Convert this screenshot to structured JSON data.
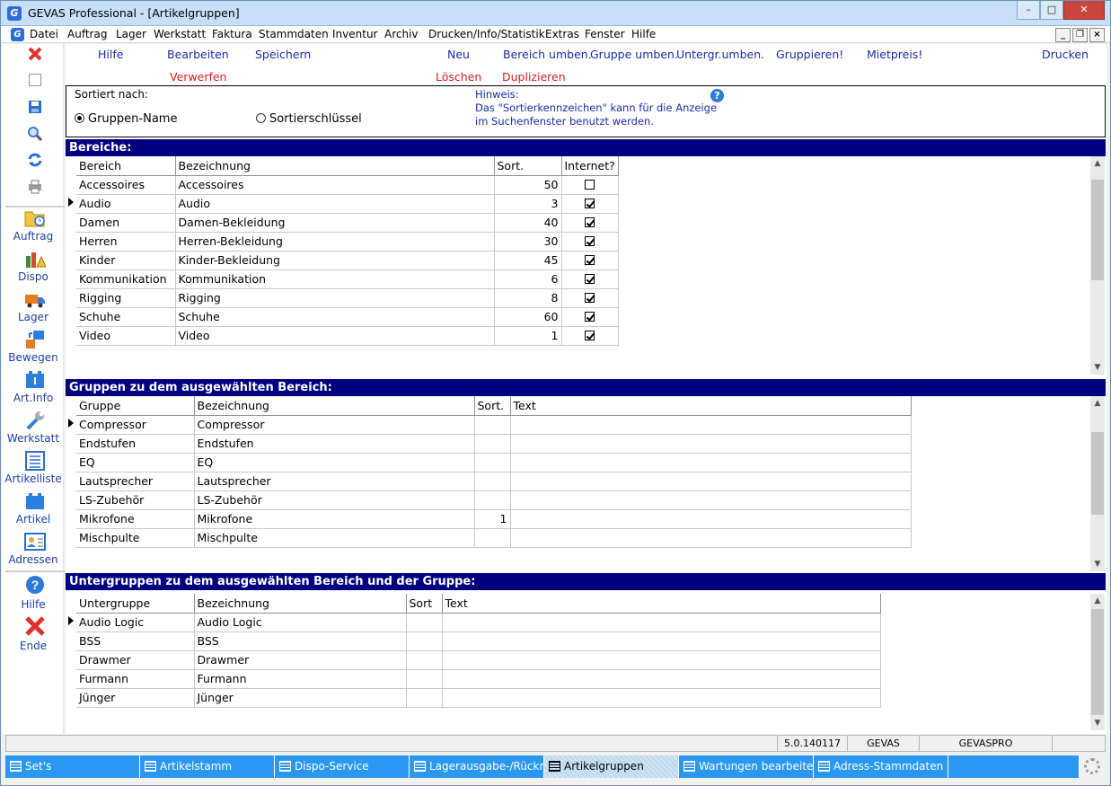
{
  "window": {
    "title": "GEVAS Professional - [Artikelgruppen]",
    "controls": {
      "minimize": "–",
      "maximize": "□",
      "close": "✕"
    },
    "mdi_controls": {
      "minimize": "_",
      "restore": "❐",
      "close": "×"
    }
  },
  "menu": [
    "Datei",
    "Auftrag",
    "Lager",
    "Werkstatt",
    "Faktura",
    "Stammdaten",
    "Inventur",
    "Archiv",
    "Drucken/Info/Statistik",
    "Extras",
    "Fenster",
    "Hilfe"
  ],
  "sidebar": {
    "items": [
      {
        "label": "Auftrag",
        "icon": "folder-clock-icon"
      },
      {
        "label": "Dispo",
        "icon": "warning-chart-icon"
      },
      {
        "label": "Lager",
        "icon": "truck-icon"
      },
      {
        "label": "Bewegen",
        "icon": "move-arrows-icon"
      },
      {
        "label": "Art.Info",
        "icon": "info-box-icon"
      },
      {
        "label": "Werkstatt",
        "icon": "wrench-icon"
      },
      {
        "label": "Artikelliste",
        "icon": "list-icon"
      },
      {
        "label": "Artikel",
        "icon": "box-icon"
      },
      {
        "label": "Adressen",
        "icon": "address-card-icon"
      },
      {
        "label": "Hilfe",
        "icon": "help-icon"
      },
      {
        "label": "Ende",
        "icon": "exit-icon"
      }
    ]
  },
  "toolbar": {
    "row1": [
      "Hilfe",
      "Bearbeiten",
      "Speichern",
      "Neu",
      "Bereich umben.",
      "Gruppe umben.",
      "Untergr.umben.",
      "Gruppieren!",
      "Mietpreis!",
      "Drucken"
    ],
    "row2": [
      "Verwerfen",
      "Löschen",
      "Duplizieren"
    ]
  },
  "sort": {
    "label": "Sortiert nach:",
    "options": [
      "Gruppen-Name",
      "Sortierschlüssel"
    ],
    "selected": "Gruppen-Name",
    "hint_title": "Hinweis:",
    "hint_line1": "Das \"Sortierkennzeichen\" kann für die Anzeige",
    "hint_line2": "im Suchenfenster benutzt werden."
  },
  "bereiche": {
    "title": "Bereiche:",
    "columns": [
      "Bereich",
      "Bezeichnung",
      "Sort.",
      "Internet?"
    ],
    "rows": [
      {
        "bereich": "Accessoires",
        "bezeichnung": "Accessoires",
        "sort": "50",
        "internet": false
      },
      {
        "bereich": "Audio",
        "bezeichnung": "Audio",
        "sort": "3",
        "internet": true
      },
      {
        "bereich": "Damen",
        "bezeichnung": "Damen-Bekleidung",
        "sort": "40",
        "internet": true
      },
      {
        "bereich": "Herren",
        "bezeichnung": "Herren-Bekleidung",
        "sort": "30",
        "internet": true
      },
      {
        "bereich": "Kinder",
        "bezeichnung": "Kinder-Bekleidung",
        "sort": "45",
        "internet": true
      },
      {
        "bereich": "Kommunikation",
        "bezeichnung": "Kommunikation",
        "sort": "6",
        "internet": true
      },
      {
        "bereich": "Rigging",
        "bezeichnung": "Rigging",
        "sort": "8",
        "internet": true
      },
      {
        "bereich": "Schuhe",
        "bezeichnung": "Schuhe",
        "sort": "60",
        "internet": true
      },
      {
        "bereich": "Video",
        "bezeichnung": "Video",
        "sort": "1",
        "internet": true
      }
    ],
    "selected_index": 1
  },
  "gruppen": {
    "title": "Gruppen zu dem ausgewählten Bereich:",
    "columns": [
      "Gruppe",
      "Bezeichnung",
      "Sort.",
      "Text"
    ],
    "rows": [
      {
        "gruppe": "Compressor",
        "bezeichnung": "Compressor",
        "sort": "",
        "text": ""
      },
      {
        "gruppe": "Endstufen",
        "bezeichnung": "Endstufen",
        "sort": "",
        "text": ""
      },
      {
        "gruppe": "EQ",
        "bezeichnung": "EQ",
        "sort": "",
        "text": ""
      },
      {
        "gruppe": "Lautsprecher",
        "bezeichnung": "Lautsprecher",
        "sort": "",
        "text": ""
      },
      {
        "gruppe": "LS-Zubehör",
        "bezeichnung": "LS-Zubehör",
        "sort": "",
        "text": ""
      },
      {
        "gruppe": "Mikrofone",
        "bezeichnung": "Mikrofone",
        "sort": "1",
        "text": ""
      },
      {
        "gruppe": "Mischpulte",
        "bezeichnung": "Mischpulte",
        "sort": "",
        "text": ""
      }
    ],
    "selected_index": 0
  },
  "untergruppen": {
    "title": "Untergruppen zu dem ausgewählten Bereich und der Gruppe:",
    "columns": [
      "Untergruppe",
      "Bezeichnung",
      "Sort",
      "Text"
    ],
    "rows": [
      {
        "untergruppe": "Audio Logic",
        "bezeichnung": "Audio Logic",
        "sort": "",
        "text": ""
      },
      {
        "untergruppe": "BSS",
        "bezeichnung": "BSS",
        "sort": "",
        "text": ""
      },
      {
        "untergruppe": "Drawmer",
        "bezeichnung": "Drawmer",
        "sort": "",
        "text": ""
      },
      {
        "untergruppe": "Furmann",
        "bezeichnung": "Furmann",
        "sort": "",
        "text": ""
      },
      {
        "untergruppe": "Jünger",
        "bezeichnung": "Jünger",
        "sort": "",
        "text": ""
      }
    ],
    "selected_index": 0
  },
  "statusbar": {
    "version": "5.0.140117",
    "user": "GEVAS",
    "db": "GEVASPRO"
  },
  "taskbar": [
    {
      "label": "Set's",
      "active": false
    },
    {
      "label": "Artikelstamm",
      "active": false
    },
    {
      "label": "Dispo-Service",
      "active": false
    },
    {
      "label": "Lagerausgabe-/Rückn...",
      "active": false
    },
    {
      "label": "Artikelgruppen",
      "active": true
    },
    {
      "label": "Wartungen bearbeiten",
      "active": false
    },
    {
      "label": "Adress-Stammdaten",
      "active": false
    }
  ],
  "colors": {
    "section": "#000080",
    "toolbar_blue": "#1a2ca8",
    "toolbar_red": "#d81d1d",
    "taskbar": "#2a98f0"
  }
}
